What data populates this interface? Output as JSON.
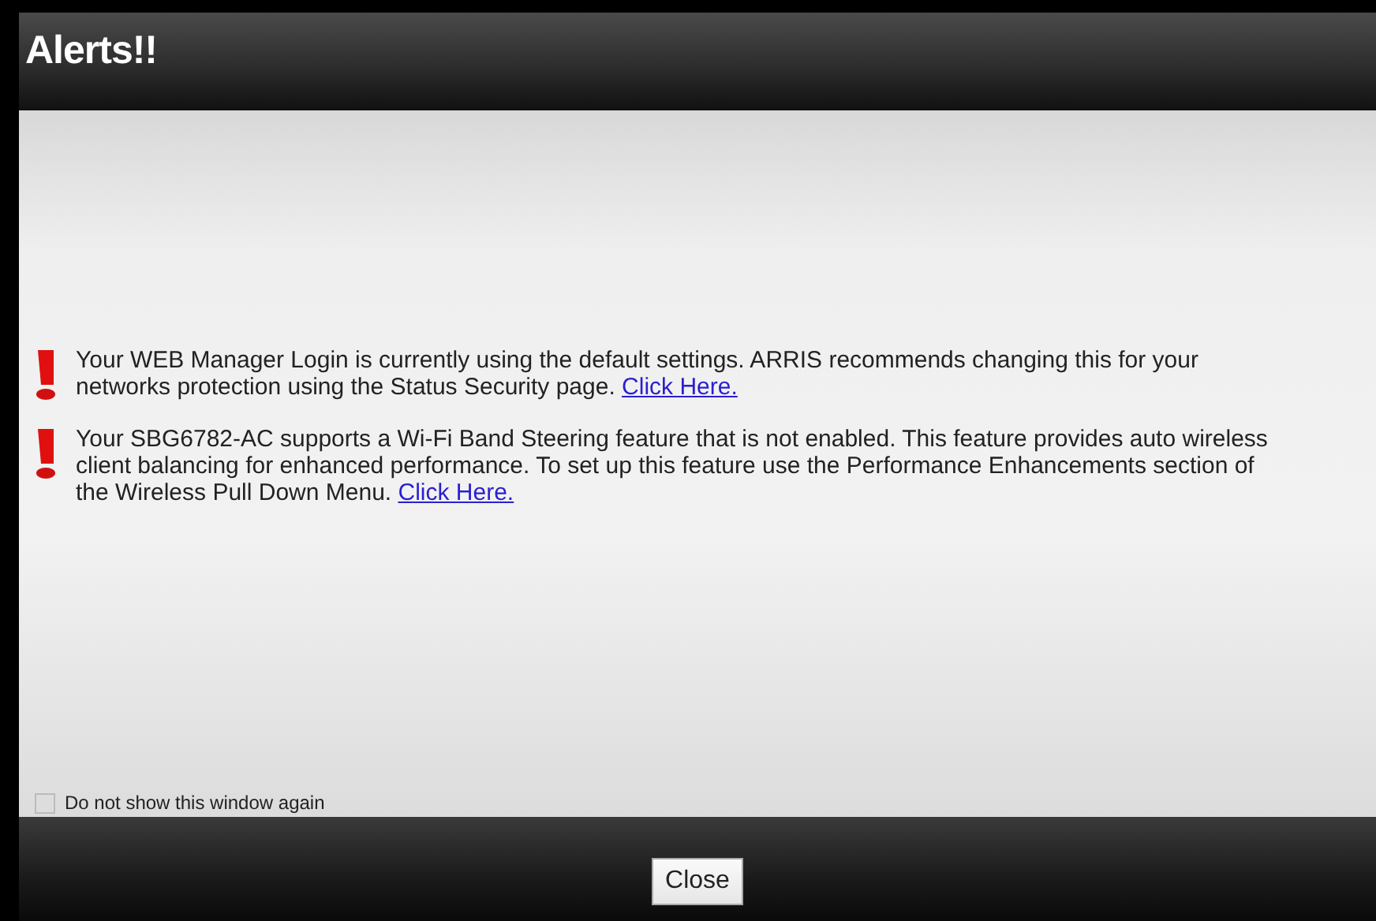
{
  "window": {
    "title": "Alerts!!"
  },
  "alerts": [
    {
      "text": "Your WEB Manager Login is currently using the default settings. ARRIS recommends changing this for your networks protection using the Status Security page.",
      "link": "Click Here."
    },
    {
      "text": "Your SBG6782-AC supports a Wi-Fi Band Steering feature that is not enabled. This feature provides auto wireless client balancing for enhanced performance. To set up this feature use the Performance Enhancements section of the Wireless Pull Down Menu.",
      "link": "Click Here."
    }
  ],
  "dont_show_again": {
    "label": "Do not show this window again",
    "checked": false
  },
  "buttons": [
    "Close"
  ]
}
